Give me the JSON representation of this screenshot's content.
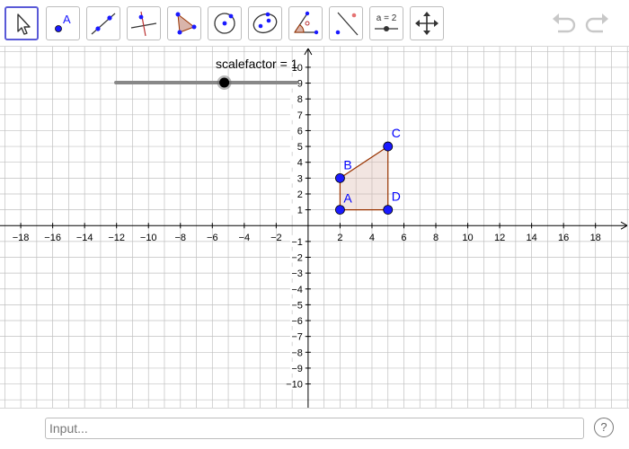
{
  "toolbar": {
    "tools": [
      {
        "icon": "move-arrow-icon",
        "active": true
      },
      {
        "icon": "point-icon",
        "glyph": "A"
      },
      {
        "icon": "line-through-points-icon"
      },
      {
        "icon": "perpendicular-line-icon"
      },
      {
        "icon": "polygon-icon"
      },
      {
        "icon": "circle-center-point-icon"
      },
      {
        "icon": "conic-ellipse-icon"
      },
      {
        "icon": "angle-icon"
      },
      {
        "icon": "reflect-about-line-icon"
      },
      {
        "icon": "slider-icon",
        "glyph": "a = 2"
      },
      {
        "icon": "move-graphics-view-icon"
      }
    ],
    "undo_icon": "undo-icon",
    "redo_icon": "redo-icon"
  },
  "slider": {
    "label": "scalefactor = 1",
    "value": 1,
    "min": -5,
    "max": 5
  },
  "axes": {
    "x_range": [
      -19.3,
      20.1
    ],
    "y_range": [
      -11.5,
      11.3
    ],
    "x_tick_step": 2,
    "y_tick_step": 1,
    "x_labels": [
      "−18",
      "−16",
      "−14",
      "−12",
      "−10",
      "−8",
      "−6",
      "−4",
      "−2",
      "2",
      "4",
      "6",
      "8",
      "10",
      "12",
      "14",
      "16",
      "18"
    ],
    "y_labels": [
      "10",
      "9",
      "8",
      "7",
      "6",
      "5",
      "4",
      "3",
      "2",
      "1",
      "−1",
      "−2",
      "−3",
      "−4",
      "−5",
      "−6",
      "−7",
      "−8",
      "−9",
      "−10"
    ],
    "grid": true
  },
  "polygon": {
    "fill": "#d9b4aa",
    "stroke": "#993300",
    "vertices": [
      "A",
      "B",
      "C",
      "D"
    ]
  },
  "points": [
    {
      "name": "A",
      "x": 2,
      "y": 1,
      "label": "A"
    },
    {
      "name": "B",
      "x": 2,
      "y": 3,
      "label": "B"
    },
    {
      "name": "C",
      "x": 5,
      "y": 5,
      "label": "C"
    },
    {
      "name": "D",
      "x": 5,
      "y": 1,
      "label": "D"
    }
  ],
  "colors": {
    "point": "#1a1aff",
    "point_label": "#0000ff",
    "grid": "#c0c0c0",
    "axis": "#000000",
    "toolbar_active": "#5a5ad7"
  },
  "input": {
    "placeholder": "Input..."
  },
  "help": {
    "label": "?"
  }
}
